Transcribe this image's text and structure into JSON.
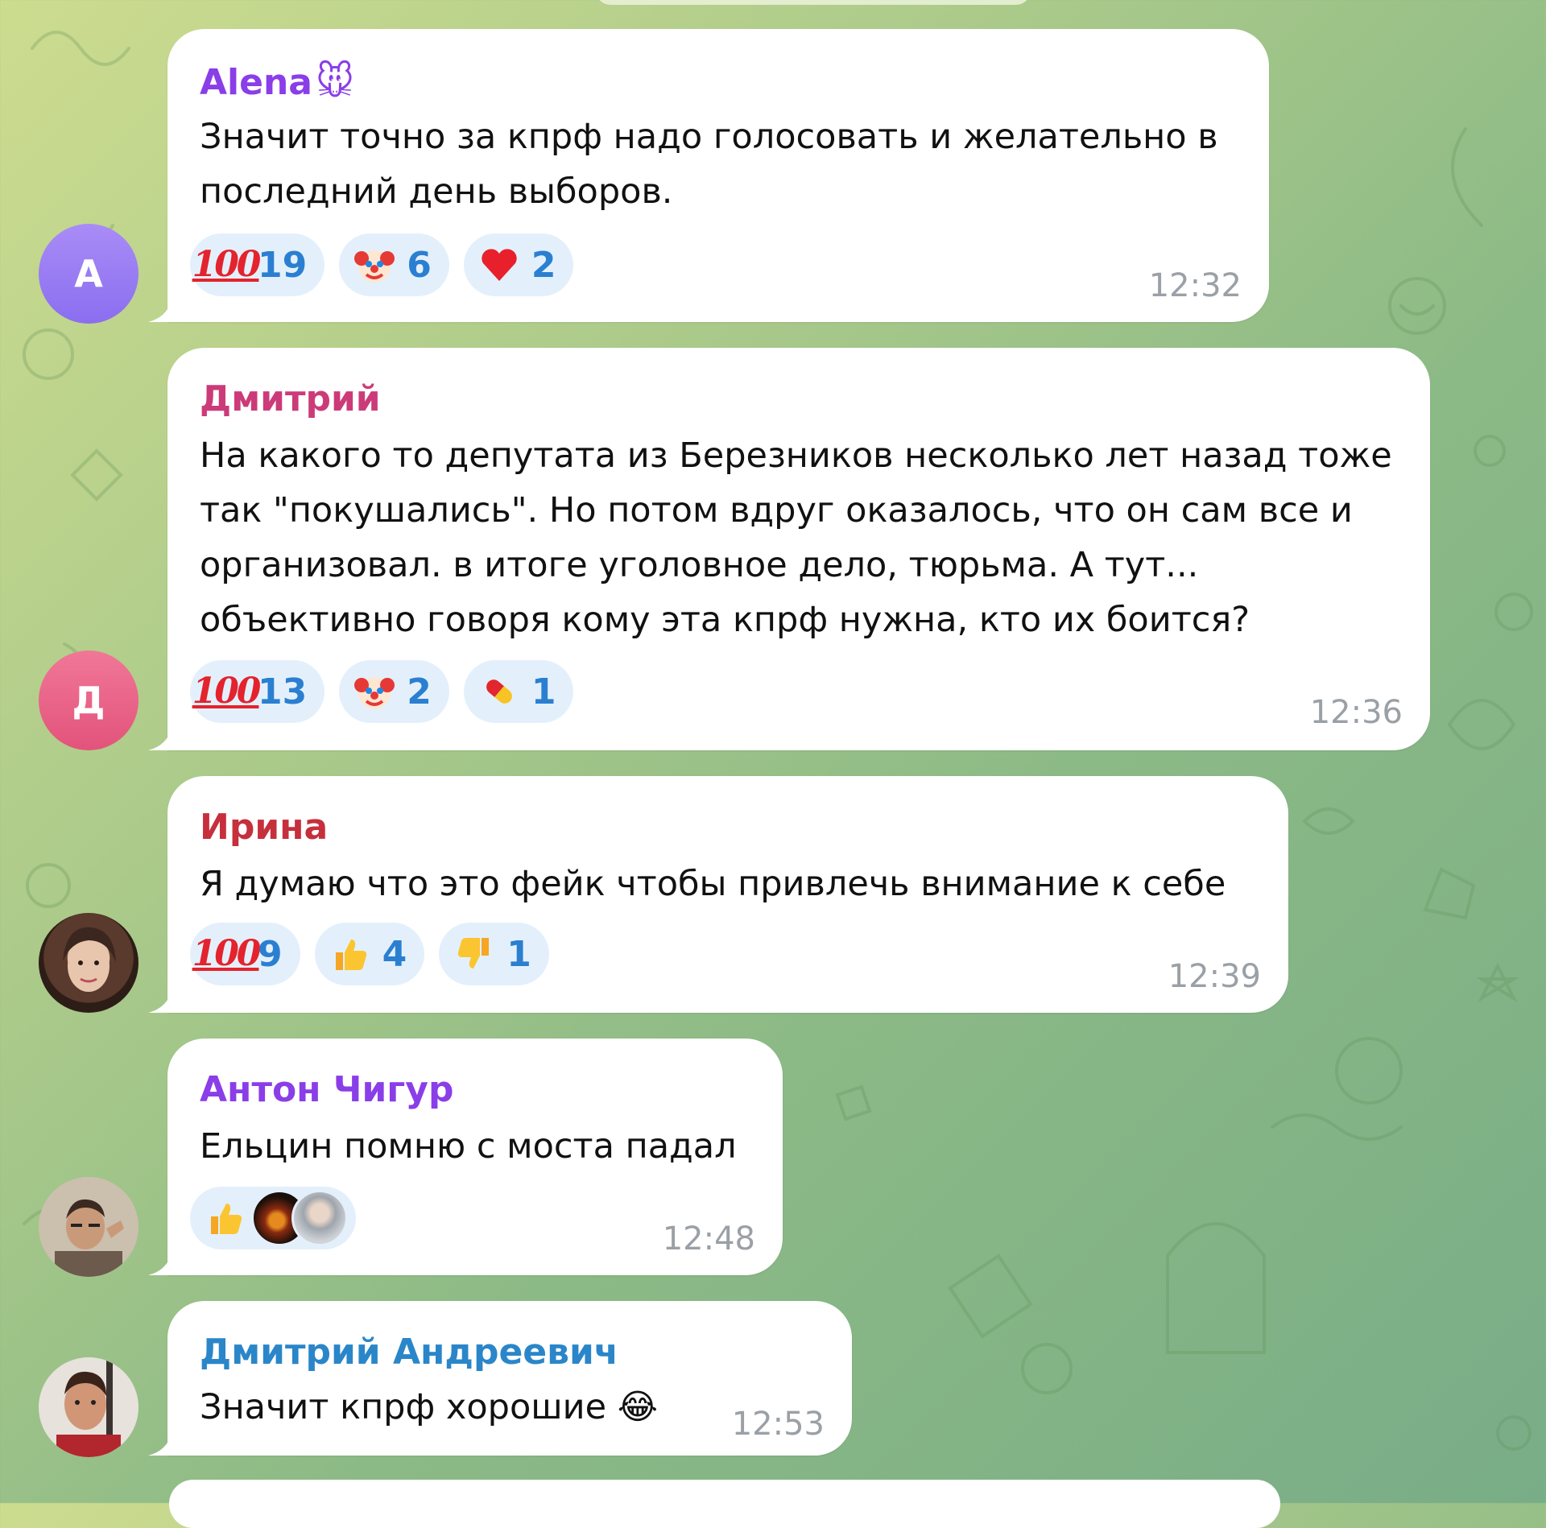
{
  "colors": {
    "reaction_count": "#2b7fd1",
    "timestamp": "#9aa0a6",
    "bubble": "#ffffff",
    "reaction_bg": "#e3f0fb"
  },
  "messages": [
    {
      "author": "Alena",
      "author_emoji": "🐭",
      "author_color": "#8a3ee8",
      "avatar_letter": "A",
      "avatar_color": "#9b7cf0",
      "lines": [
        "Значит точно за кпрф надо голосовать и желательно в",
        "последний день выборов."
      ],
      "reactions": [
        {
          "icon": "hundred-points-icon",
          "count": "19"
        },
        {
          "icon": "clown-face-icon",
          "count": "6"
        },
        {
          "icon": "red-heart-icon",
          "count": "2"
        }
      ],
      "time": "12:32"
    },
    {
      "author": "Дмитрий",
      "author_color": "#cc3b79",
      "avatar_letter": "Д",
      "avatar_color": "#ec5c83",
      "lines": [
        "На какого то депутата из Березников несколько лет назад тоже",
        "так \"покушались\". Но потом вдруг оказалось, что он сам все и",
        "организовал. в итоге уголовное дело, тюрьма.  А тут...",
        "объективно говоря кому эта кпрф  нужна, кто их боится?"
      ],
      "reactions": [
        {
          "icon": "hundred-points-icon",
          "count": "13"
        },
        {
          "icon": "clown-face-icon",
          "count": "2"
        },
        {
          "icon": "pill-icon",
          "count": "1"
        }
      ],
      "time": "12:36"
    },
    {
      "author": "Ирина",
      "author_color": "#c62f3c",
      "avatar_icon": "user-photo-avatar",
      "lines": [
        "Я думаю что это фейк чтобы привлечь внимание к себе"
      ],
      "reactions": [
        {
          "icon": "hundred-points-icon",
          "count": "9"
        },
        {
          "icon": "thumbs-up-icon",
          "count": "4"
        },
        {
          "icon": "thumbs-down-icon",
          "count": "1"
        }
      ],
      "time": "12:39"
    },
    {
      "author": "Антон Чигур",
      "author_color": "#8a3ee8",
      "avatar_icon": "user-photo-avatar",
      "lines": [
        "Ельцин помню с моста падал"
      ],
      "reactions": [
        {
          "icon": "thumbs-up-icon",
          "count": ""
        }
      ],
      "time": "12:48"
    },
    {
      "author": "Дмитрий Андреевич",
      "author_color": "#2a86c9",
      "avatar_icon": "user-photo-avatar",
      "lines": [
        "Значит кпрф хорошие 😂"
      ],
      "time": "12:53"
    }
  ]
}
